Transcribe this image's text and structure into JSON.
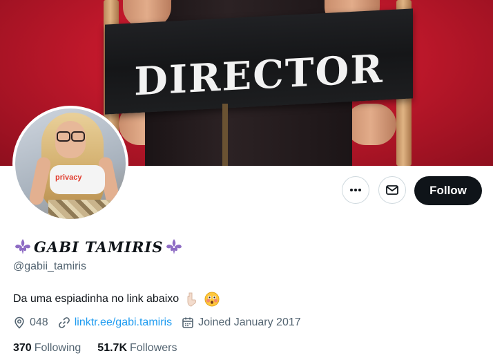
{
  "banner": {
    "chair_text": "DIRECTOR"
  },
  "profile": {
    "display_name": "GABI TAMIRIS",
    "name_decoration_icon": "fleur-de-lis",
    "handle": "@gabii_tamiris",
    "bio": "Da uma espiadinha no link abaixo",
    "bio_emojis": [
      "pointing-down-hand",
      "flushed-face"
    ],
    "location": "048",
    "website": "linktr.ee/gabi.tamiris",
    "joined": "Joined January 2017",
    "following_count": "370",
    "following_label": "Following",
    "followers_count": "51.7K",
    "followers_label": "Followers"
  },
  "avatar": {
    "shirt_text": "privacy"
  },
  "actions": {
    "more_icon": "more-horizontal",
    "message_icon": "envelope",
    "follow_label": "Follow"
  },
  "colors": {
    "link": "#1d9bf0",
    "banner_red": "#c0182b",
    "follow_bg": "#0f1419",
    "secondary_text": "#536471",
    "fleur_purple": "#8e6cc4"
  }
}
